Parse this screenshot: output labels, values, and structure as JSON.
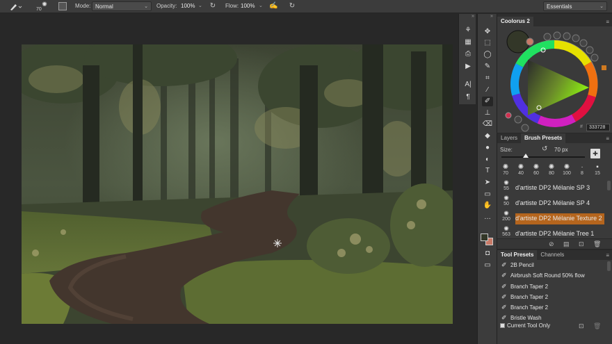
{
  "options_bar": {
    "brush_size": "70",
    "mode_label": "Mode:",
    "mode_value": "Normal",
    "opacity_label": "Opacity:",
    "opacity_value": "100%",
    "flow_label": "Flow:",
    "flow_value": "100%",
    "workspace": "Essentials"
  },
  "coolorus": {
    "tab": "Coolorus 2",
    "hex_value": "333728",
    "foreground_color": "#333728",
    "background_color": "#c97a67"
  },
  "brush_panel": {
    "tabs": [
      "Layers",
      "Brush Presets"
    ],
    "active_tab": "Brush Presets",
    "size_label": "Size:",
    "size_value": "70 px",
    "size_fraction": 0.29,
    "sprite_sizes": [
      "70",
      "40",
      "60",
      "80",
      "100",
      "8",
      "15"
    ],
    "brushes": [
      {
        "size": "55",
        "name": "d'artiste DP2 Mélanie SP 3"
      },
      {
        "size": "50",
        "name": "d'artiste DP2 Mélanie SP 4"
      },
      {
        "size": "200",
        "name": "d'artiste DP2 Mélanie Texture 2",
        "selected": true
      },
      {
        "size": "563",
        "name": "d'artiste DP2 Mélanie Tree 1"
      }
    ]
  },
  "tool_presets_panel": {
    "tabs": [
      "Tool Presets",
      "Channels"
    ],
    "active_tab": "Tool Presets",
    "presets": [
      "2B Pencil",
      "Airbrush Soft Round 50% flow",
      "Branch Taper 2",
      "Branch Taper 2",
      "Branch Taper 2",
      "Bristle Wash"
    ],
    "current_tool_only": "Current Tool Only"
  }
}
